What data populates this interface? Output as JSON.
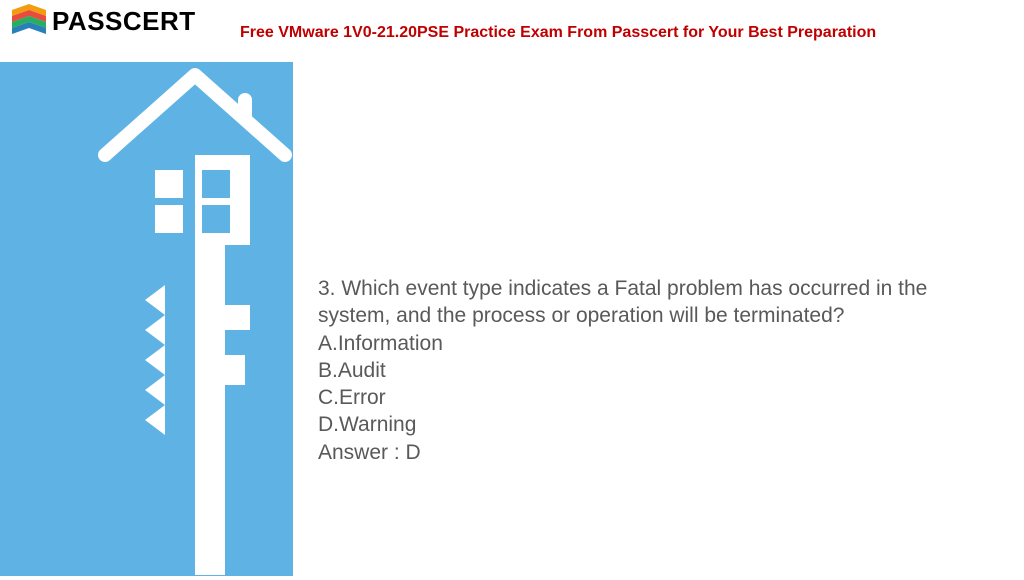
{
  "logo": {
    "text": "PASSCERT"
  },
  "header": {
    "title": "Free VMware 1V0-21.20PSE Practice Exam From Passcert for Your Best Preparation"
  },
  "question": {
    "number": "3.",
    "text": "Which event type indicates a Fatal problem has occurred in the system, and the process or operation will be terminated?",
    "options": {
      "a": "A.Information",
      "b": "B.Audit",
      "c": "C.Error",
      "d": "D.Warning"
    },
    "answer": "Answer : D"
  }
}
